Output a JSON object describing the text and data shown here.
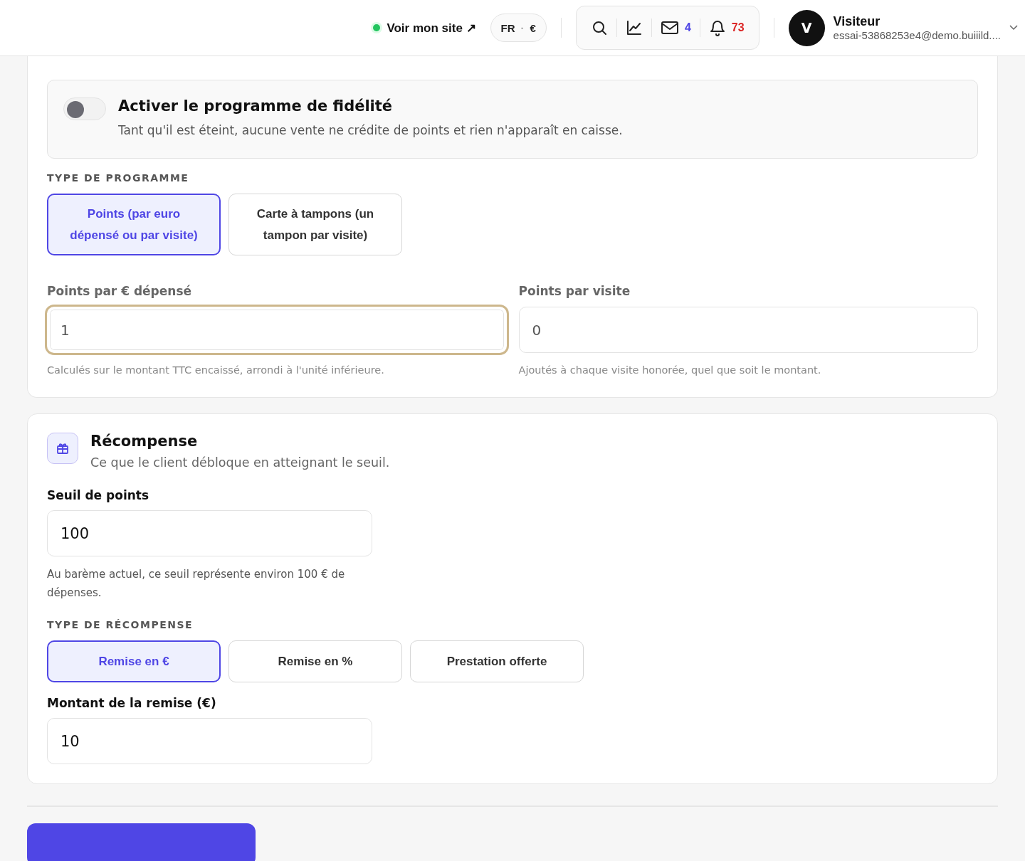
{
  "header": {
    "site_link": {
      "label": "Voir mon site ↗",
      "online": true
    },
    "locale": {
      "language": "FR",
      "separator": "·",
      "currency": "€"
    },
    "toolbar": [
      {
        "kind": "search"
      },
      {
        "kind": "chart"
      },
      {
        "kind": "mail",
        "count": "4",
        "color": "#4f46e5"
      },
      {
        "kind": "bell",
        "count": "73",
        "color": "#dc2626"
      }
    ],
    "user": {
      "initial": "V",
      "name": "Visiteur",
      "email": "essai-53868253e4@demo.buiiild...."
    }
  },
  "program": {
    "toggle": {
      "on": false,
      "title": "Activer le programme de fidélité",
      "description": "Tant qu'il est éteint, aucune vente ne crédite de points et rien n'apparaît en caisse."
    },
    "type_label": "TYPE DE PROGRAMME",
    "types": [
      {
        "label": "Points (par euro dépensé ou par visite)",
        "selected": true
      },
      {
        "label": "Carte à tampons (un tampon par visite)",
        "selected": false
      }
    ],
    "fields": [
      {
        "label": "Points par € dépensé",
        "value": "1",
        "focused": true,
        "hint": "Calculés sur le montant TTC encaissé, arrondi à l'unité inférieure."
      },
      {
        "label": "Points par visite",
        "value": "0",
        "focused": false,
        "hint": "Ajoutés à chaque visite honorée, quel que soit le montant."
      }
    ]
  },
  "reward": {
    "title": "Récompense",
    "subtitle": "Ce que le client débloque en atteignant le seuil.",
    "threshold": {
      "label": "Seuil de points",
      "value": "100",
      "hint": "Au barème actuel, ce seuil représente environ 100 € de dépenses."
    },
    "type_label": "TYPE DE RÉCOMPENSE",
    "types": [
      {
        "label": "Remise en €",
        "selected": true
      },
      {
        "label": "Remise en %",
        "selected": false
      },
      {
        "label": "Prestation offerte",
        "selected": false
      }
    ],
    "amount": {
      "label": "Montant de la remise (€)",
      "value": "10"
    }
  }
}
